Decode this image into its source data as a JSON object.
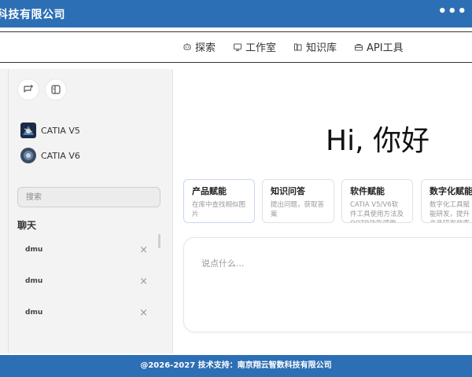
{
  "header": {
    "title": "科技有限公司",
    "menu_icon": "more-dots-icon",
    "menu_label": "•••",
    "background_color": "#2d6fb5"
  },
  "nav": {
    "items": [
      {
        "label": "探索",
        "icon": "robot-icon"
      },
      {
        "label": "工作室",
        "icon": "monitor-icon"
      },
      {
        "label": "知识库",
        "icon": "library-icon"
      },
      {
        "label": "API工具",
        "icon": "toolbox-icon"
      }
    ]
  },
  "sidebar": {
    "new_chat_icon": "new-chat-icon",
    "toggle_icon": "sidebar-toggle-icon",
    "models": [
      {
        "label": "CATIA V5"
      },
      {
        "label": "CATIA V6"
      }
    ],
    "search_placeholder": "搜索",
    "section_title": "聊天",
    "chats": [
      {
        "label": "dmu"
      },
      {
        "label": "dmu"
      },
      {
        "label": "dmu"
      }
    ],
    "close_symbol": "×"
  },
  "main": {
    "greeting": "Hi, 你好",
    "cards": [
      {
        "title": "产品赋能",
        "desc": "在库中查找相似图片"
      },
      {
        "title": "知识问答",
        "desc": "提出问题，获取答案"
      },
      {
        "title": "软件赋能",
        "desc": "CATIA V5/V6软件工具使用方法及OOTB功能调用"
      },
      {
        "title": "数字化赋能",
        "desc": "数字化工具赋能研发，提升产品研发效率及质量"
      }
    ],
    "input_placeholder": "说点什么..."
  },
  "footer": {
    "text": "@2026-2027 技术支持：南京翔云智数科技有限公司"
  }
}
